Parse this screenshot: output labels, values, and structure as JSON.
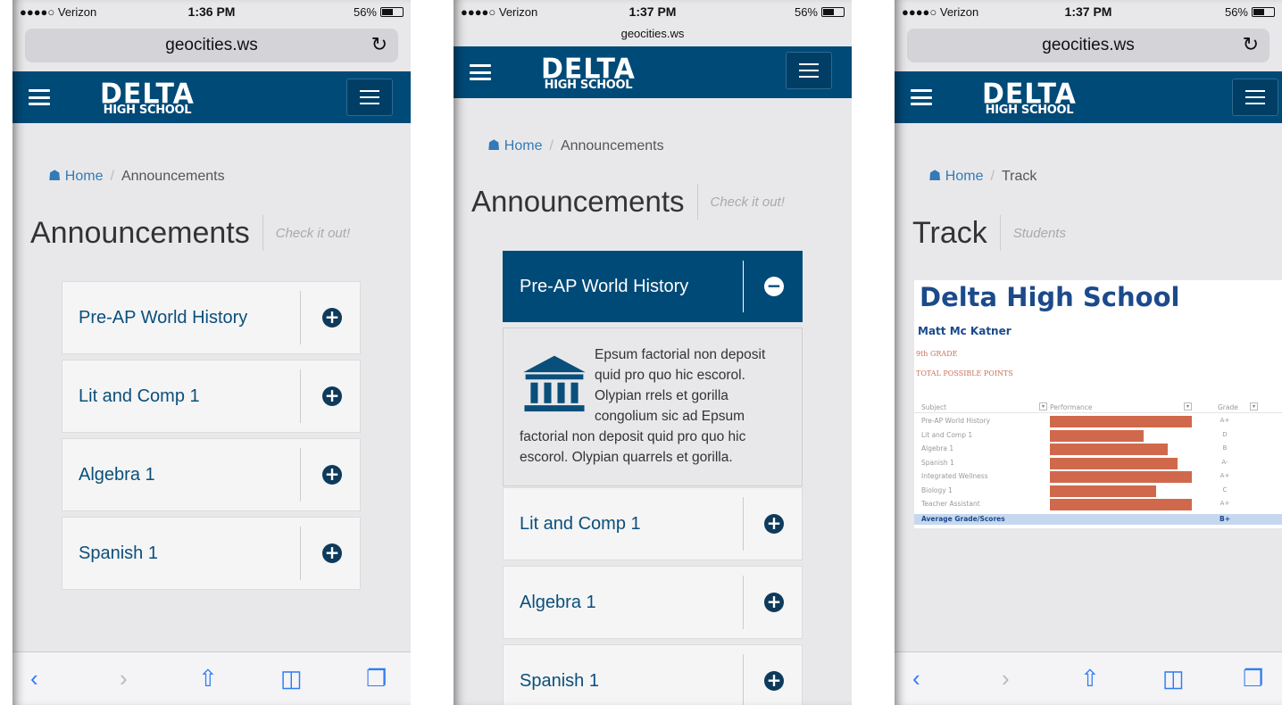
{
  "status": {
    "carrier": "●●●●○ Verizon",
    "battery": "56%",
    "battery_fraction": 0.56,
    "p1_time": "1:36 PM",
    "p2_time": "1:37 PM",
    "p3_time": "1:37 PM"
  },
  "browser": {
    "url": "geocities.ws"
  },
  "logo": {
    "big": "DELTA",
    "small": "HIGH SCHOOL"
  },
  "announcements": {
    "crumb_home": "Home",
    "crumb_current": "Announcements",
    "title": "Announcements",
    "subtitle": "Check it out!",
    "items": [
      {
        "label": "Pre-AP World History",
        "state": "collapsed"
      },
      {
        "label": "Lit and Comp 1",
        "state": "collapsed"
      },
      {
        "label": "Algebra 1",
        "state": "collapsed"
      },
      {
        "label": "Spanish 1",
        "state": "collapsed"
      }
    ],
    "expanded_text": "Epsum factorial non deposit quid pro quo hic escorol. Olypian rrels et gorilla congolium sic ad Epsum factorial non deposit quid pro quo hic escorol. Olypian quarrels et gorilla."
  },
  "track": {
    "crumb_home": "Home",
    "crumb_current": "Track",
    "title": "Track",
    "subtitle": "Students",
    "sheet": {
      "school": "Delta High School",
      "student": "Matt Mc Katner",
      "grade_level": "9th GRADE",
      "points_label": "TOTAL POSSIBLE POINTS",
      "col_subject": "Subject",
      "col_performance": "Performance",
      "col_grade": "Grade",
      "avg_label": "Average Grade/Scores",
      "avg_value": "B+"
    }
  },
  "chart_data": {
    "type": "bar",
    "title": "Delta High School",
    "categories": [
      "Pre-AP World History",
      "Lit and Comp 1",
      "Algebra 1",
      "Spanish 1",
      "Integrated Wellness",
      "Biology 1",
      "Teacher Assistant"
    ],
    "values": [
      100,
      66,
      83,
      90,
      100,
      75,
      100
    ],
    "grades": [
      "A+",
      "D",
      "B",
      "A-",
      "A+",
      "C",
      "A+"
    ],
    "ylabel": "Performance",
    "ylim": [
      0,
      100
    ],
    "orientation": "horizontal"
  },
  "colors": {
    "navbar": "#004a78",
    "link": "#337ab7",
    "bar": "#d0694c",
    "avg_row": "#c6d8ef",
    "sheet_title": "#1c4a8b"
  },
  "icons": [
    "hamburger-icon",
    "home-icon",
    "plus-circle-icon",
    "minus-circle-icon",
    "bank-icon",
    "back-icon",
    "forward-icon",
    "share-icon",
    "bookmarks-icon",
    "tabs-icon",
    "reload-icon"
  ]
}
